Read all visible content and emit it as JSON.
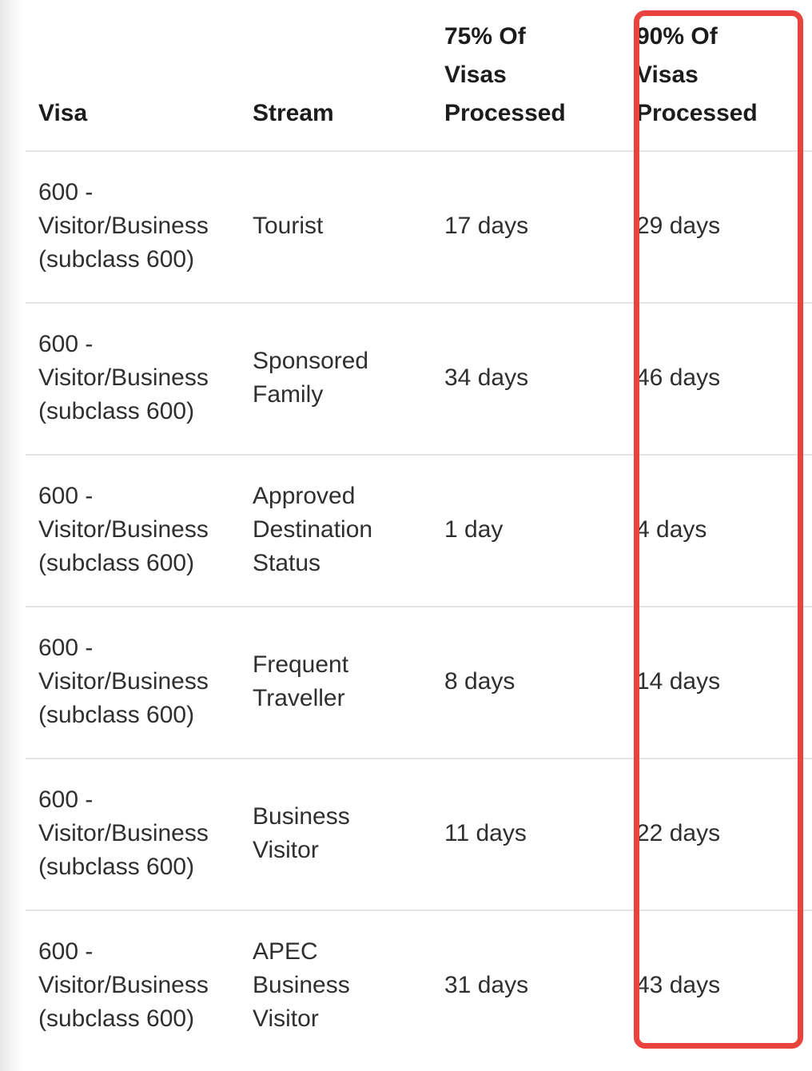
{
  "table": {
    "columns": [
      {
        "key": "visa",
        "label": "Visa",
        "label_lines": [
          "Visa"
        ]
      },
      {
        "key": "stream",
        "label": "Stream",
        "label_lines": [
          "Stream"
        ]
      },
      {
        "key": "p75",
        "label": "75% Of Visas Processed",
        "label_lines": [
          "75% Of",
          "Visas",
          "Processed"
        ]
      },
      {
        "key": "p90",
        "label": "90% Of Visas Processed",
        "label_lines": [
          "90% Of",
          "Visas",
          "Processed"
        ]
      }
    ],
    "rows": [
      {
        "visa": "600 - Visitor/Business (subclass 600)",
        "visa_lines": [
          "600 -",
          "Visitor/Business",
          "(subclass 600)"
        ],
        "stream": "Tourist",
        "stream_lines": [
          "Tourist"
        ],
        "p75": "17 days",
        "p90": "29 days"
      },
      {
        "visa": "600 - Visitor/Business (subclass 600)",
        "visa_lines": [
          "600 -",
          "Visitor/Business",
          "(subclass 600)"
        ],
        "stream": "Sponsored Family",
        "stream_lines": [
          "Sponsored",
          "Family"
        ],
        "p75": "34 days",
        "p90": "46 days"
      },
      {
        "visa": "600 - Visitor/Business (subclass 600)",
        "visa_lines": [
          "600 -",
          "Visitor/Business",
          "(subclass 600)"
        ],
        "stream": "Approved Destination Status",
        "stream_lines": [
          "Approved",
          "Destination",
          "Status"
        ],
        "p75": "1 day",
        "p90": "4 days"
      },
      {
        "visa": "600 - Visitor/Business (subclass 600)",
        "visa_lines": [
          "600 -",
          "Visitor/Business",
          "(subclass 600)"
        ],
        "stream": "Frequent Traveller",
        "stream_lines": [
          "Frequent",
          "Traveller"
        ],
        "p75": "8 days",
        "p90": "14 days"
      },
      {
        "visa": "600 - Visitor/Business (subclass 600)",
        "visa_lines": [
          "600 -",
          "Visitor/Business",
          "(subclass 600)"
        ],
        "stream": "Business Visitor",
        "stream_lines": [
          "Business",
          "Visitor"
        ],
        "p75": "11 days",
        "p90": "22 days"
      },
      {
        "visa": "600 - Visitor/Business (subclass 600)",
        "visa_lines": [
          "600 -",
          "Visitor/Business",
          "(subclass 600)"
        ],
        "stream": "APEC Business Visitor",
        "stream_lines": [
          "APEC",
          "Business",
          "Visitor"
        ],
        "p75": "31 days",
        "p90": "43 days"
      }
    ]
  },
  "annotation": {
    "target_column": "90% Of Visas Processed",
    "color": "#e8433c",
    "shape": "rounded-rectangle"
  },
  "colors": {
    "text": "#2f2f2f",
    "header_text": "#1c1c1c",
    "divider": "#e4e4e4",
    "background": "#ffffff",
    "annotation_red": "#e8433c"
  }
}
